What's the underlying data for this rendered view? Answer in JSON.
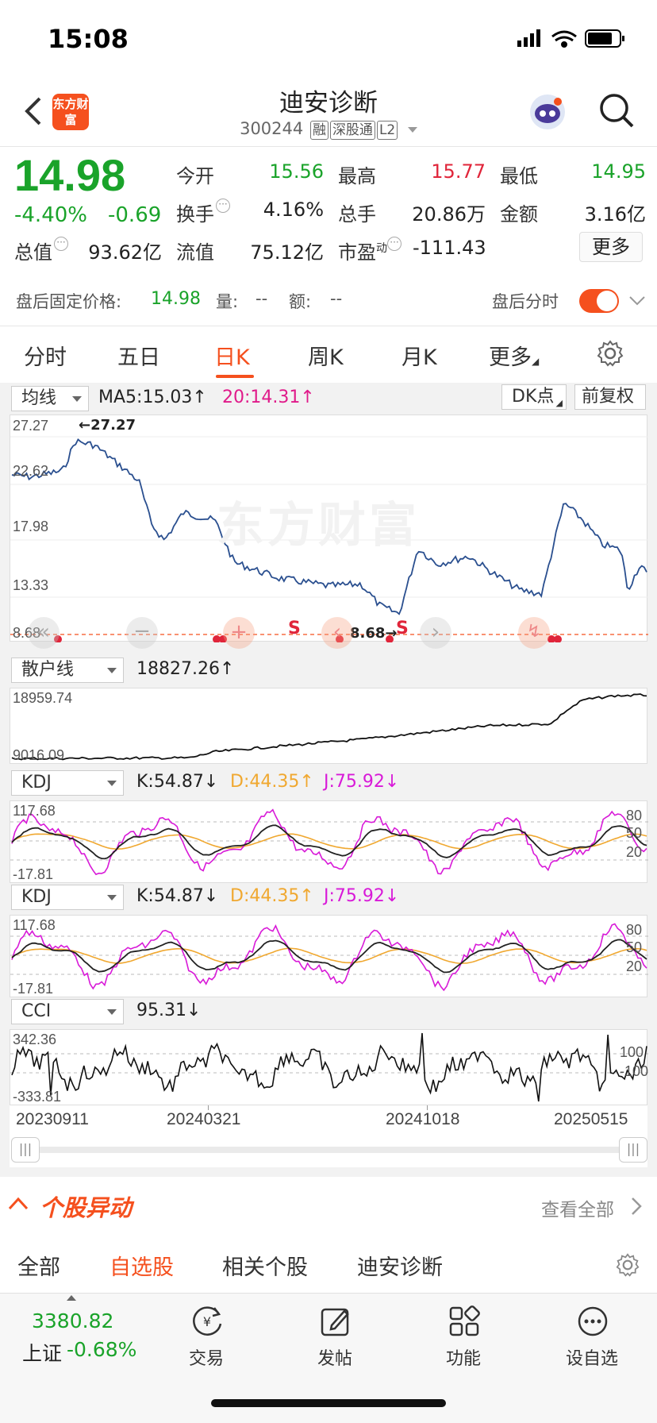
{
  "status": {
    "time": "15:08"
  },
  "header": {
    "logo_text": "东方财富",
    "stock_name": "迪安诊断",
    "stock_code": "300244",
    "tags": [
      "融",
      "深股通",
      "L2"
    ]
  },
  "quote": {
    "price": "14.98",
    "change_pct": "-4.40%",
    "change_amt": "-0.69",
    "open_label": "今开",
    "open_value": "15.56",
    "high_label": "最高",
    "high_value": "15.77",
    "low_label": "最低",
    "low_value": "14.95",
    "turnover_label": "换手",
    "turnover_value": "4.16%",
    "volume_label": "总手",
    "volume_value": "20.86万",
    "amount_label": "金额",
    "amount_value": "3.16亿",
    "mktcap_label": "总值",
    "mktcap_value": "93.62亿",
    "float_label": "流值",
    "float_value": "75.12亿",
    "pe_label": "市盈",
    "pe_sup": "动",
    "pe_value": "-111.43",
    "more_label": "更多"
  },
  "after_hours": {
    "label": "盘后固定价格:",
    "price": "14.98",
    "vol_label": "量:",
    "vol_value": "--",
    "amt_label": "额:",
    "amt_value": "--",
    "timeshare_label": "盘后分时",
    "toggle_on": true
  },
  "period_tabs": [
    "分时",
    "五日",
    "日K",
    "周K",
    "月K",
    "更多"
  ],
  "active_tab": "日K",
  "main_chart": {
    "indicator": "均线",
    "ma5": "MA5:15.03↑",
    "ma20": "20:14.31↑",
    "dk_label": "DK点",
    "adjust_label": "前复权",
    "watermark": "东方财富",
    "y_ticks": [
      "27.27",
      "22.62",
      "17.98",
      "13.33",
      "8.68"
    ],
    "max_marker": "27.27",
    "min_marker": "8.68",
    "signals": [
      "S",
      "S"
    ]
  },
  "retail_panel": {
    "indicator": "散户线",
    "value": "18827.26↑",
    "y_max": "18959.74",
    "y_min": "9016.09"
  },
  "kdj1": {
    "indicator": "KDJ",
    "k": "K:54.87↓",
    "d": "D:44.35↑",
    "j": "J:75.92↓",
    "y_max": "117.68",
    "y_min": "-17.81",
    "right_ticks": [
      "80",
      "50",
      "20"
    ]
  },
  "kdj2": {
    "indicator": "KDJ",
    "k": "K:54.87↓",
    "d": "D:44.35↑",
    "j": "J:75.92↓",
    "y_max": "117.68",
    "y_min": "-17.81",
    "right_ticks": [
      "80",
      "50",
      "20"
    ]
  },
  "cci": {
    "indicator": "CCI",
    "value": "95.31↓",
    "y_max": "342.36",
    "y_min": "-333.81",
    "right_ticks": [
      "100",
      "-100"
    ]
  },
  "x_dates": [
    "20230911",
    "20240321",
    "20241018",
    "20250515"
  ],
  "news": {
    "title": "个股异动",
    "view_all": "查看全部",
    "tabs": [
      "全部",
      "自选股",
      "相关个股",
      "迪安诊断"
    ],
    "active": "自选股"
  },
  "bottom": {
    "index_value": "3380.82",
    "index_name": "上证",
    "index_change": "-0.68%",
    "items": [
      "交易",
      "发帖",
      "功能",
      "设自选"
    ]
  },
  "colors": {
    "green": "#1aa32a",
    "red": "#e0253a",
    "accent": "#f5501e",
    "line_blue": "#2a4f8f",
    "kdj_k": "#222222",
    "kdj_d": "#f0a830",
    "kdj_j": "#d81ad8"
  }
}
